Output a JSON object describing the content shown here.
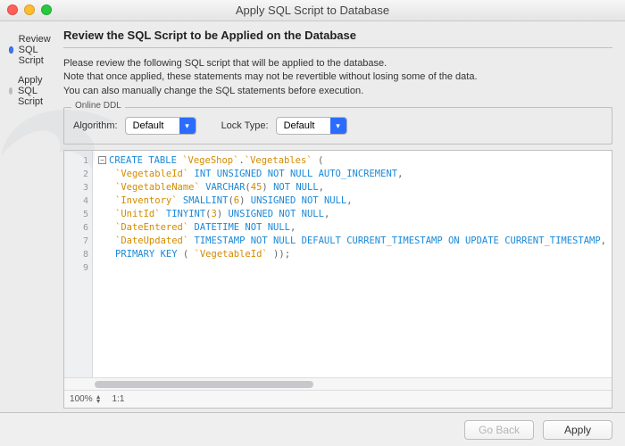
{
  "window": {
    "title": "Apply SQL Script to Database"
  },
  "sidebar": {
    "steps": [
      {
        "label": "Review SQL Script",
        "active": true
      },
      {
        "label": "Apply SQL Script",
        "active": false
      }
    ]
  },
  "main": {
    "heading": "Review the SQL Script to be Applied on the Database",
    "desc_line1": "Please review the following SQL script that will be applied to the database.",
    "desc_line2": "Note that once applied, these statements may not be revertible without losing some of the data.",
    "desc_line3": "You can also manually change the SQL statements before execution.",
    "ddl": {
      "legend": "Online DDL",
      "algorithm_label": "Algorithm:",
      "algorithm_value": "Default",
      "lock_label": "Lock Type:",
      "lock_value": "Default"
    },
    "editor": {
      "line_numbers": [
        "1",
        "2",
        "3",
        "4",
        "5",
        "6",
        "7",
        "8",
        "9"
      ],
      "zoom": "100%",
      "ratio": "1:1",
      "sql": {
        "schema": "VegeShop",
        "table": "Vegetables",
        "columns": [
          {
            "name": "VegetableId",
            "type": "INT UNSIGNED NOT NULL AUTO_INCREMENT"
          },
          {
            "name": "VegetableName",
            "type": "VARCHAR",
            "size": "45",
            "post": "NOT NULL"
          },
          {
            "name": "Inventory",
            "type": "SMALLINT",
            "size": "6",
            "post": "UNSIGNED NOT NULL"
          },
          {
            "name": "UnitId",
            "type": "TINYINT",
            "size": "3",
            "post": "UNSIGNED NOT NULL"
          },
          {
            "name": "DateEntered",
            "type": "DATETIME NOT NULL"
          },
          {
            "name": "DateUpdated",
            "type": "TIMESTAMP NOT NULL DEFAULT CURRENT_TIMESTAMP ON UPDATE CURRENT_TIMESTAMP"
          }
        ],
        "primary_key": "VegetableId"
      }
    }
  },
  "footer": {
    "go_back": "Go Back",
    "apply": "Apply"
  }
}
